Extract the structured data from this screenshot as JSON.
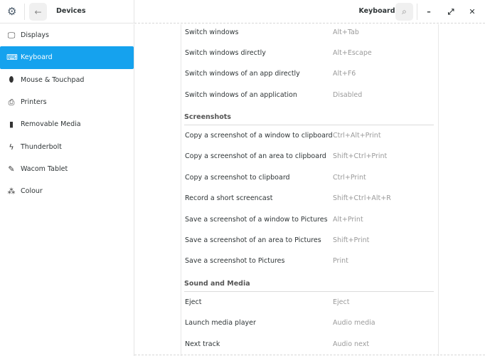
{
  "header": {
    "left_title": "Devices",
    "title": "Keyboard"
  },
  "sidebar": {
    "items": [
      {
        "label": "Displays",
        "icon": "display-icon",
        "glyph": "🖵"
      },
      {
        "label": "Keyboard",
        "icon": "keyboard-icon",
        "glyph": "⌨",
        "active": true
      },
      {
        "label": "Mouse & Touchpad",
        "icon": "mouse-icon",
        "glyph": "⬮"
      },
      {
        "label": "Printers",
        "icon": "printer-icon",
        "glyph": "⎙"
      },
      {
        "label": "Removable Media",
        "icon": "usb-icon",
        "glyph": "▮"
      },
      {
        "label": "Thunderbolt",
        "icon": "thunderbolt-icon",
        "glyph": "ϟ"
      },
      {
        "label": "Wacom Tablet",
        "icon": "tablet-icon",
        "glyph": "✎"
      },
      {
        "label": "Colour",
        "icon": "colour-icon",
        "glyph": "⁂"
      }
    ]
  },
  "shortcuts": {
    "group0": [
      {
        "name": "Switch windows",
        "key": "Alt+Tab"
      },
      {
        "name": "Switch windows directly",
        "key": "Alt+Escape"
      },
      {
        "name": "Switch windows of an app directly",
        "key": "Alt+F6"
      },
      {
        "name": "Switch windows of an application",
        "key": "Disabled"
      }
    ],
    "screenshots_title": "Screenshots",
    "screenshots": [
      {
        "name": "Copy a screenshot of a window to clipboard",
        "key": "Ctrl+Alt+Print"
      },
      {
        "name": "Copy a screenshot of an area to clipboard",
        "key": "Shift+Ctrl+Print"
      },
      {
        "name": "Copy a screenshot to clipboard",
        "key": "Ctrl+Print"
      },
      {
        "name": "Record a short screencast",
        "key": "Shift+Ctrl+Alt+R"
      },
      {
        "name": "Save a screenshot of a window to Pictures",
        "key": "Alt+Print"
      },
      {
        "name": "Save a screenshot of an area to Pictures",
        "key": "Shift+Print"
      },
      {
        "name": "Save a screenshot to Pictures",
        "key": "Print"
      }
    ],
    "sound_title": "Sound and Media",
    "sound": [
      {
        "name": "Eject",
        "key": "Eject"
      },
      {
        "name": "Launch media player",
        "key": "Audio media"
      },
      {
        "name": "Next track",
        "key": "Audio next"
      }
    ]
  },
  "accent": "#15a2ee"
}
